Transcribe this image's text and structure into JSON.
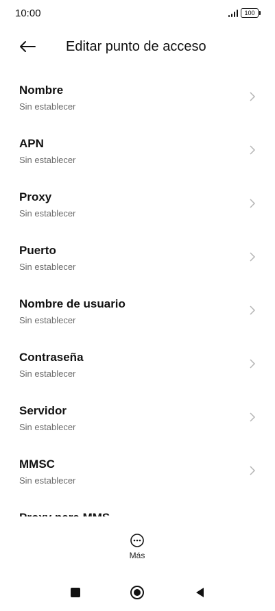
{
  "status": {
    "time": "10:00",
    "battery": "100"
  },
  "header": {
    "title": "Editar punto de acceso"
  },
  "items": [
    {
      "title": "Nombre",
      "subtitle": "Sin establecer"
    },
    {
      "title": "APN",
      "subtitle": "Sin establecer"
    },
    {
      "title": "Proxy",
      "subtitle": "Sin establecer"
    },
    {
      "title": "Puerto",
      "subtitle": "Sin establecer"
    },
    {
      "title": "Nombre de usuario",
      "subtitle": "Sin establecer"
    },
    {
      "title": "Contraseña",
      "subtitle": "Sin establecer"
    },
    {
      "title": "Servidor",
      "subtitle": "Sin establecer"
    },
    {
      "title": "MMSC",
      "subtitle": "Sin establecer"
    },
    {
      "title": "Proxy para MMS",
      "subtitle": ""
    }
  ],
  "bottom": {
    "more_label": "Más"
  },
  "nav": {
    "buttons": [
      "square-icon",
      "home-circle-icon",
      "back-triangle-icon"
    ]
  }
}
